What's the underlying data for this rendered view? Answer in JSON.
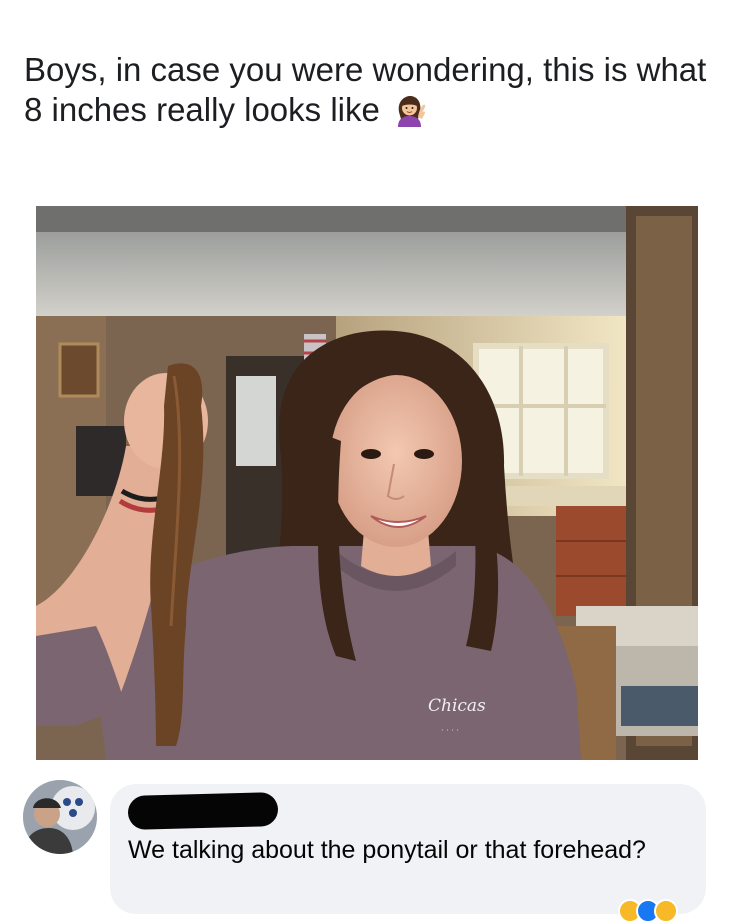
{
  "post": {
    "text": "Boys, in case you were wondering, this is what 8 inches really looks like",
    "emoji": "woman-tipping-hand-icon"
  },
  "photo": {
    "shirt_text": "Chicas"
  },
  "comment": {
    "author": "",
    "text": "We talking about the ponytail or that forehead?"
  },
  "colors": {
    "text": "#1c1e21",
    "bubble": "#f0f2f5",
    "shirt": "#7a6570"
  }
}
